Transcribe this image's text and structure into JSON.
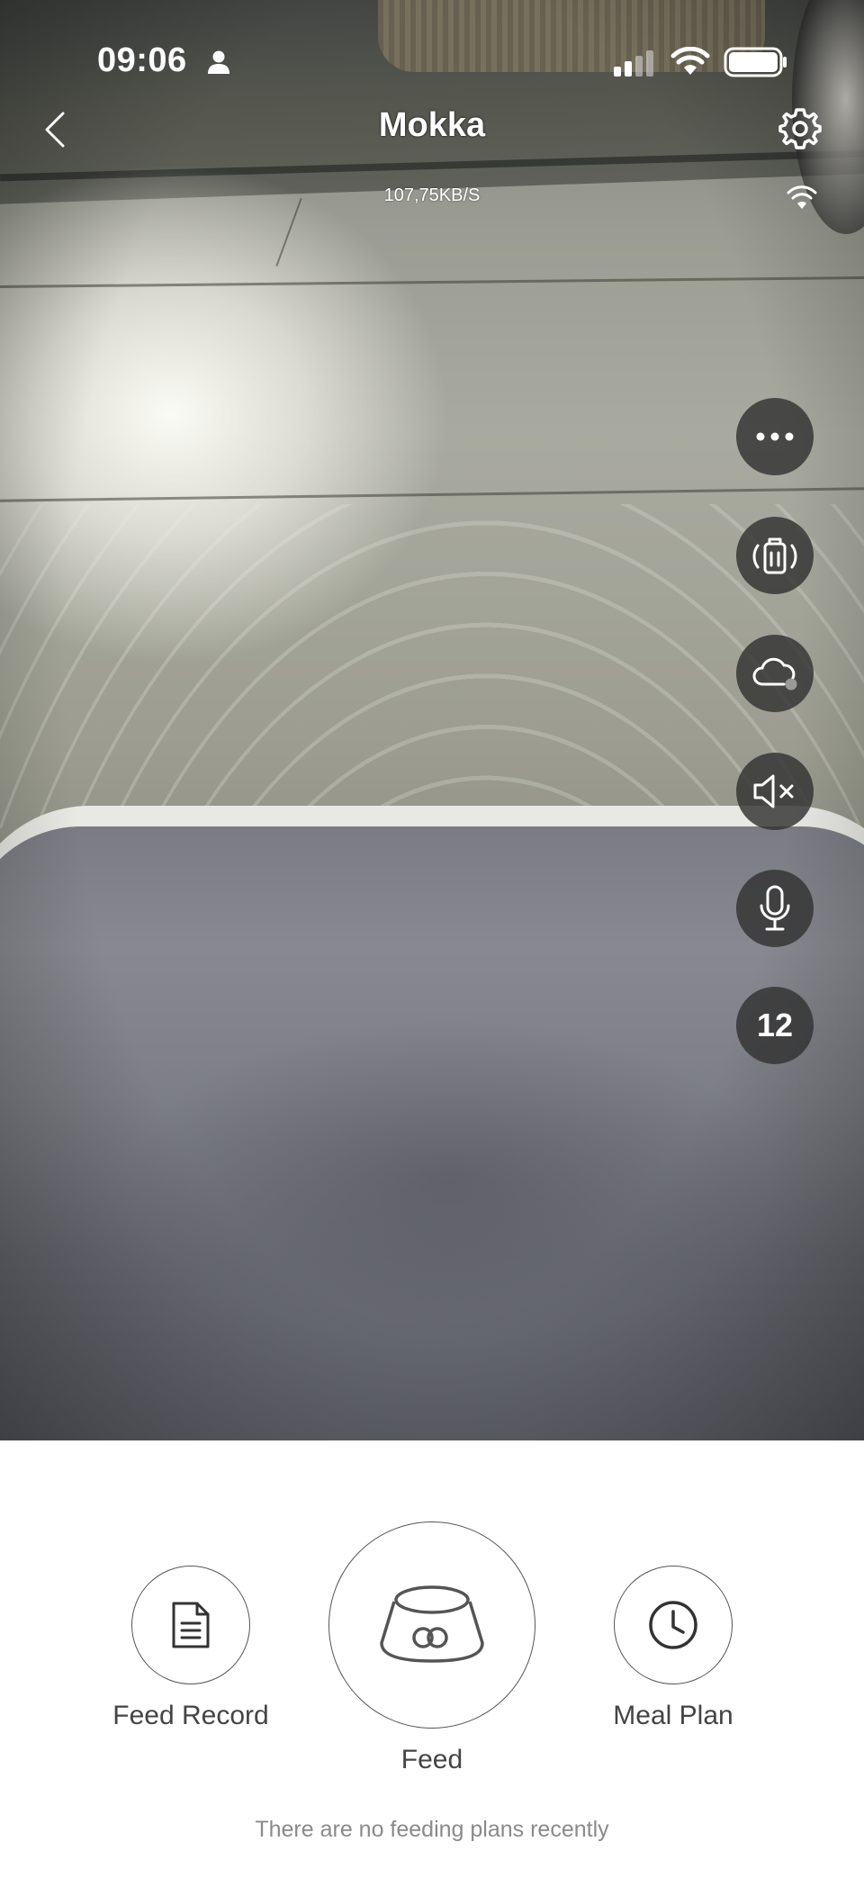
{
  "status_bar": {
    "time": "09:06"
  },
  "header": {
    "title": "Mokka",
    "data_rate": "107,75KB/S"
  },
  "side_controls": {
    "more_icon": "ellipsis-icon",
    "rotate_icon": "device-rotate-icon",
    "cloud_icon": "cloud-icon",
    "mute_icon": "speaker-muted-icon",
    "mic_icon": "microphone-icon",
    "count": "12"
  },
  "actions": {
    "feed_record": "Feed Record",
    "feed": "Feed",
    "meal_plan": "Meal Plan"
  },
  "hint": "There are no feeding plans recently",
  "colors": {
    "control_bg": "#323232",
    "panel_bg": "#ffffff",
    "hint_text": "#8a8a8a"
  }
}
